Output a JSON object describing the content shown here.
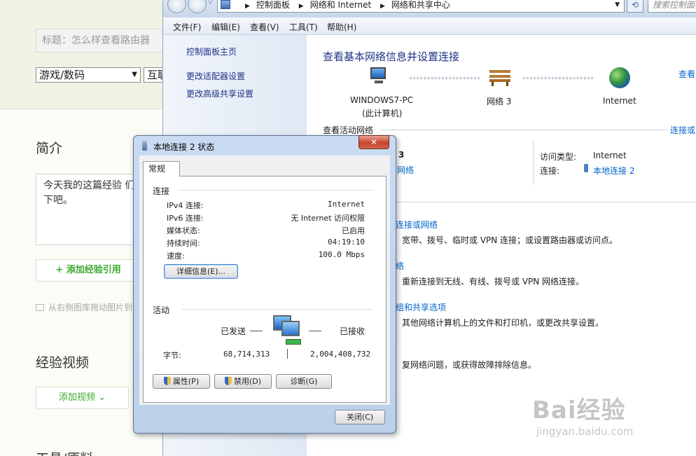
{
  "editor": {
    "title_placeholder": "标题：怎么样查看路由器",
    "category_select": "游戏/数码",
    "category_select2": "互联",
    "intro_heading": "简介",
    "intro_text": "今天我的这篇经验 们快来看下吧。",
    "add_reference_button": "+ 添加经验引用",
    "drag_hint": "从右侧图库拖动图片到",
    "video_heading": "经验视频",
    "add_video_button": "添加视频 ⌄",
    "tools_heading": "工具/原料"
  },
  "control_panel": {
    "breadcrumb": [
      "控制面板",
      "网络和 Internet",
      "网络和共享中心"
    ],
    "search_placeholder": "搜索控制面板",
    "menu": [
      "文件(F)",
      "编辑(E)",
      "查看(V)",
      "工具(T)",
      "帮助(H)"
    ],
    "sidebar": [
      "控制面板主页",
      "更改适配器设置",
      "更改高级共享设置"
    ],
    "main_title": "查看基本网络信息并设置连接",
    "view_full_map": "查看完",
    "nodes": {
      "computer_name": "WINDOWS7-PC",
      "computer_sub": "(此计算机)",
      "network": "网络  3",
      "internet": "Internet"
    },
    "active_network_label": "查看活动网络",
    "connect_or_disconnect": "连接或断开",
    "active_net_name": "3",
    "active_net_type": "网络",
    "access_type_label": "访问类型:",
    "access_type_value": "Internet",
    "connection_label": "连接:",
    "connection_value": "本地连接 2",
    "tasks": [
      {
        "link": "连接或网络",
        "desc": "宽带、拨号、临时或 VPN 连接；或设置路由器或访问点。"
      },
      {
        "link": "络",
        "desc": "重新连接到无线、有线、拨号或 VPN 网络连接。"
      },
      {
        "link": "组和共享选项",
        "desc": "其他网络计算机上的文件和打印机，或更改共享设置。"
      },
      {
        "link": "",
        "desc": "复网络问题，或获得故障排除信息。"
      }
    ]
  },
  "dialog": {
    "title": "本地连接 2 状态",
    "close_glyph": "✕",
    "tab_general": "常规",
    "section_connection": "连接",
    "rows": [
      {
        "label": "IPv4 连接:",
        "value": "Internet"
      },
      {
        "label": "IPv6 连接:",
        "value": "无 Internet 访问权限"
      },
      {
        "label": "媒体状态:",
        "value": "已启用"
      },
      {
        "label": "持续时间:",
        "value": "04:19:10"
      },
      {
        "label": "速度:",
        "value": "100.0 Mbps"
      }
    ],
    "details_button": "详细信息(E)...",
    "section_activity": "活动",
    "sent_label": "已发送",
    "received_label": "已接收",
    "bytes_label": "字节:",
    "bytes_sent": "68,714,313",
    "bytes_received": "2,004,408,732",
    "properties_button": "属性(P)",
    "disable_button": "禁用(D)",
    "diagnose_button": "诊断(G)",
    "close_button": "关闭(C)"
  },
  "watermark": {
    "brand": "Bai经验",
    "url": "jingyan.baidu.com"
  }
}
